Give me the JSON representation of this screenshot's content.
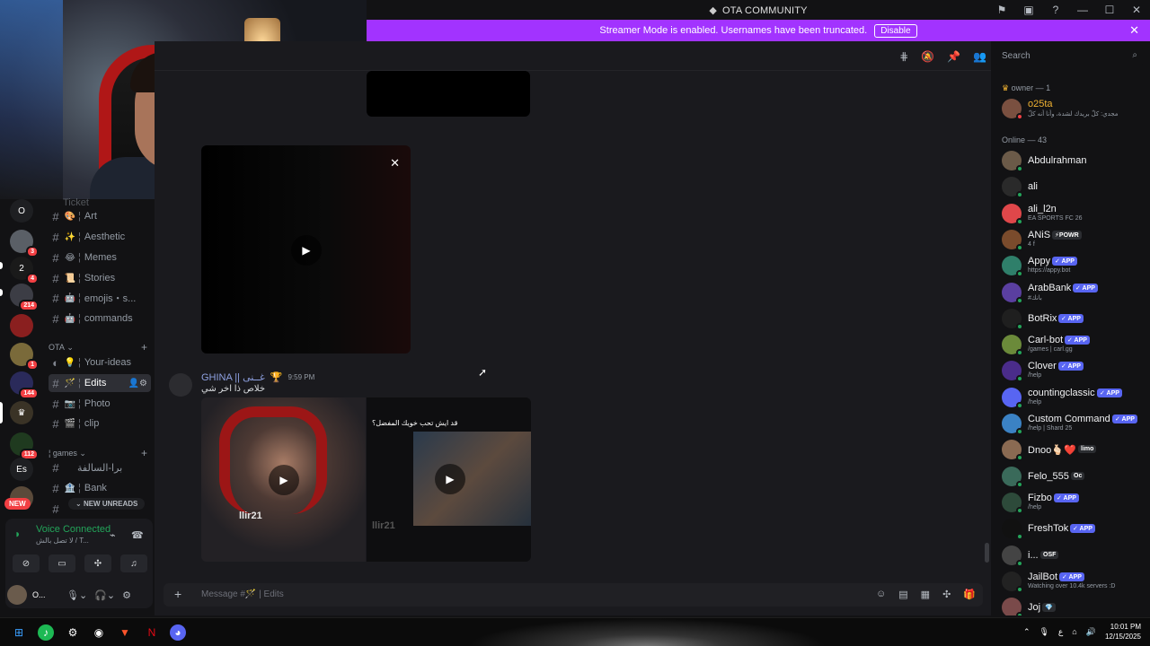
{
  "window": {
    "title": "OTA COMMUNITY",
    "title_icon": "discord-server-icon"
  },
  "banner": {
    "text": "Streamer Mode is enabled. Usernames have been truncated.",
    "button": "Disable"
  },
  "search": {
    "placeholder": "Search"
  },
  "servers": [
    {
      "label": "O",
      "badge": ""
    },
    {
      "label": "",
      "badge": "3"
    },
    {
      "label": "",
      "badge": "4"
    },
    {
      "label": "",
      "badge": "214"
    },
    {
      "label": "",
      "badge": ""
    },
    {
      "label": "",
      "badge": "1"
    },
    {
      "label": "",
      "badge": "144"
    },
    {
      "label": "",
      "badge": ""
    },
    {
      "label": "",
      "badge": "112"
    },
    {
      "label": "Es",
      "badge": ""
    }
  ],
  "new_badge": "NEW",
  "channels": {
    "top_partial": "Ticket",
    "items": [
      {
        "emoji": "🎨",
        "name": "Art"
      },
      {
        "emoji": "✨",
        "name": "Aesthetic"
      },
      {
        "emoji": "😂",
        "name": "Memes"
      },
      {
        "emoji": "📜",
        "name": "Stories"
      },
      {
        "emoji": "🤖",
        "name": "emojis・s..."
      },
      {
        "emoji": "🤖",
        "name": "commands"
      }
    ],
    "category_ota": "OTA",
    "ota_items": [
      {
        "emoji": "💡",
        "name": "Your-ideas"
      },
      {
        "emoji": "🪄",
        "name": "Edits"
      },
      {
        "emoji": "📷",
        "name": "Photo"
      },
      {
        "emoji": "🎬",
        "name": "clip"
      }
    ],
    "category_games": "games",
    "games_items": [
      {
        "emoji": "",
        "name": "برا-السالفة"
      },
      {
        "emoji": "🏦",
        "name": "Bank"
      }
    ],
    "new_unreads": "NEW UNREADS"
  },
  "voice": {
    "status": "Voice Connected",
    "sub": "لا تصل بالش / T..."
  },
  "user": {
    "name": "O..."
  },
  "message": {
    "author": "GHINA || غــنى",
    "time": "9:59 PM",
    "text": "خلاص ذا اخر شي",
    "thumb2_caption": "قد ايش تحب خويك المفضل؟",
    "watermark": "llir21"
  },
  "composer": {
    "placeholder": "Message #🪄 | Edits"
  },
  "members": {
    "owner_header": "owner — 1",
    "owner": {
      "name": "o25ta",
      "status": "مجدي: كلّ بريدك لشدة، وأنا أنه كلّ"
    },
    "online_header": "Online — 43",
    "list": [
      {
        "name": "Abdulrahman",
        "tag": "",
        "status": "",
        "color": "#6b5a48"
      },
      {
        "name": "ali",
        "tag": "",
        "status": "",
        "color": "#2a2a2a"
      },
      {
        "name": "ali_l2n",
        "tag": "",
        "status": "EA SPORTS FC 26",
        "color": "#e0474a"
      },
      {
        "name": "ANiS",
        "tag": "⚡POWR",
        "status": "4 f",
        "color": "#7a4b2c"
      },
      {
        "name": "Appy",
        "tag": "✓ APP",
        "status": "https://appy.bot",
        "color": "#2f7f6a"
      },
      {
        "name": "ArabBank",
        "tag": "✓ APP",
        "status": "#بانك",
        "color": "#5a3fa0"
      },
      {
        "name": "BotRix",
        "tag": "✓ APP",
        "status": "",
        "color": "#1f1f1f"
      },
      {
        "name": "Carl-bot",
        "tag": "✓ APP",
        "status": "/games | carl.gg",
        "color": "#6b8a3a"
      },
      {
        "name": "Clover",
        "tag": "✓ APP",
        "status": "/help",
        "color": "#4a2c8a"
      },
      {
        "name": "countingclassic",
        "tag": "✓ APP",
        "status": "/help",
        "color": "#5865f2"
      },
      {
        "name": "Custom Command",
        "tag": "✓ APP",
        "status": "/help | Shard 25",
        "color": "#3b82c4"
      },
      {
        "name": "Dnoo🫰🏻❤️",
        "tag": "limo",
        "status": "",
        "color": "#8a6a52"
      },
      {
        "name": "Felo_555",
        "tag": "Oc",
        "status": "",
        "color": "#3a6a5a"
      },
      {
        "name": "Fizbo",
        "tag": "✓ APP",
        "status": "/help",
        "color": "#2d4a3a"
      },
      {
        "name": "FreshTok",
        "tag": "✓ APP",
        "status": "",
        "color": "#111"
      },
      {
        "name": "i...",
        "tag": "OSF",
        "status": "",
        "color": "#444"
      },
      {
        "name": "JailBot",
        "tag": "✓ APP",
        "status": "Watching over 10.4k servers :D",
        "color": "#222"
      },
      {
        "name": "Joj",
        "tag": "💎",
        "status": "",
        "color": "#7a4a4a"
      }
    ]
  },
  "taskbar": {
    "time": "10:01 PM",
    "date": "12/15/2025",
    "lang": "ع"
  },
  "colors": {
    "accent": "#a233ff",
    "online": "#23a55a",
    "badge": "#f23f43",
    "blurple": "#5865f2"
  }
}
